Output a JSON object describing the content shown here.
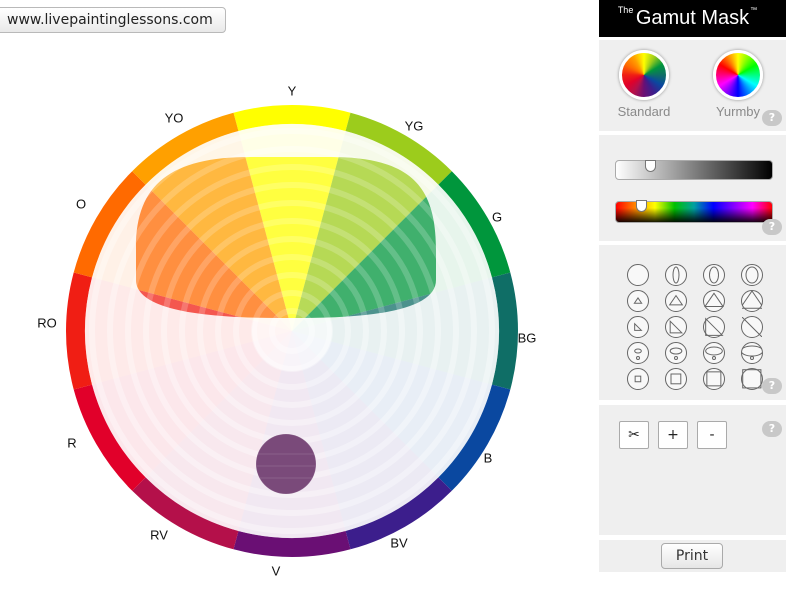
{
  "url_button": "www.livepaintinglessons.com",
  "title": {
    "pre": "The",
    "main": "Gamut Mask",
    "tm": "™"
  },
  "modes": [
    {
      "label": "Standard"
    },
    {
      "label": "Yurmby"
    }
  ],
  "help_label": "?",
  "wheel": {
    "segments": [
      {
        "label": "Y",
        "color": "#ffff00"
      },
      {
        "label": "YG",
        "color": "#9ccc1c"
      },
      {
        "label": "G",
        "color": "#00963c"
      },
      {
        "label": "BG",
        "color": "#0f6e66"
      },
      {
        "label": "B",
        "color": "#0a48a0"
      },
      {
        "label": "BV",
        "color": "#3c1e8c"
      },
      {
        "label": "V",
        "color": "#6a0f74"
      },
      {
        "label": "RV",
        "color": "#b4104a"
      },
      {
        "label": "R",
        "color": "#e1002a"
      },
      {
        "label": "RO",
        "color": "#f01e14"
      },
      {
        "label": "O",
        "color": "#ff6a00"
      },
      {
        "label": "YO",
        "color": "#ffa000"
      }
    ]
  },
  "sliders": {
    "saturation_value": 0.2,
    "hue_value": 0.14
  },
  "tools": {
    "cut_label": "✂",
    "plus_label": "+",
    "minus_label": "-"
  },
  "print_label": "Print"
}
